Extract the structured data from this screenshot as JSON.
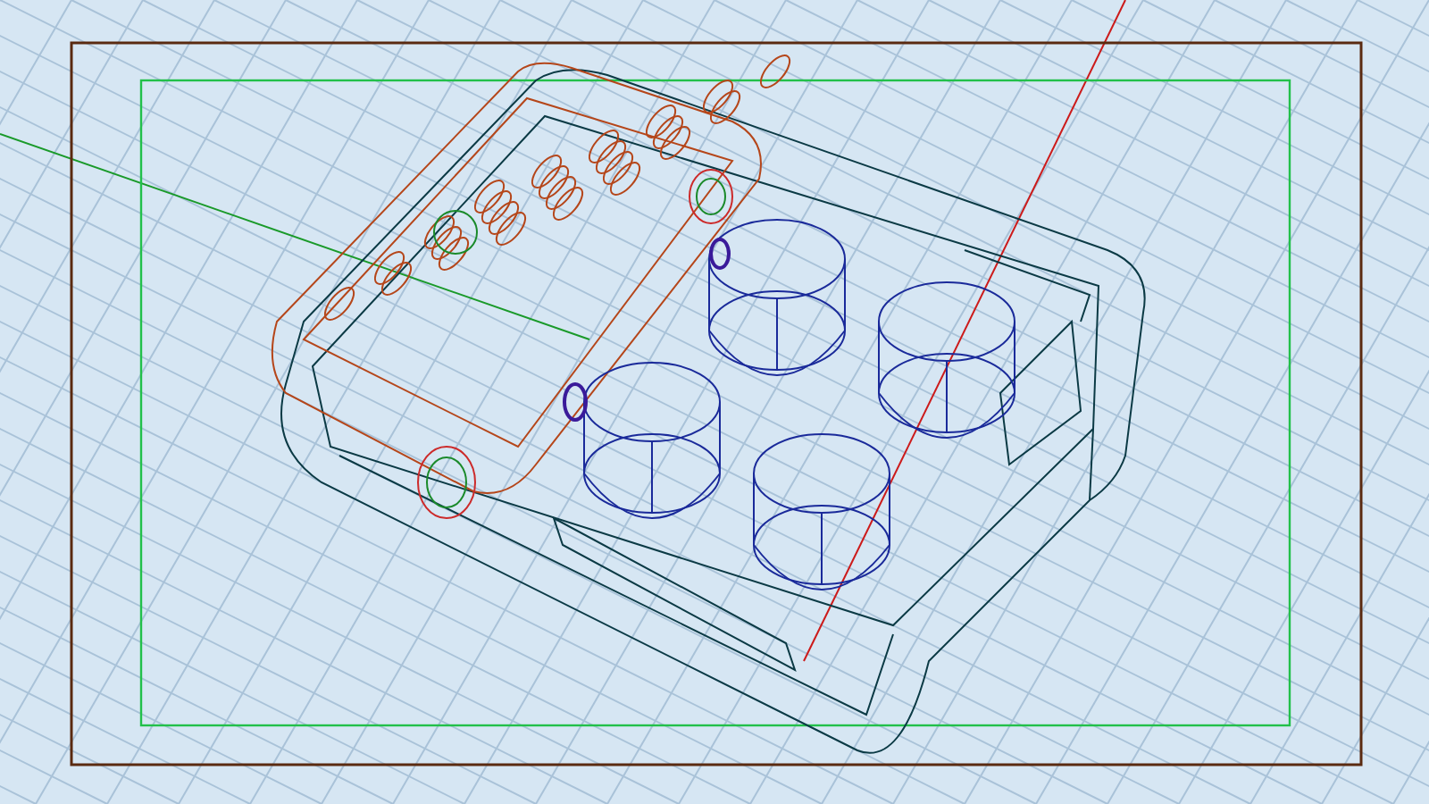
{
  "viewport": {
    "grid": true,
    "safe_frame": true
  }
}
